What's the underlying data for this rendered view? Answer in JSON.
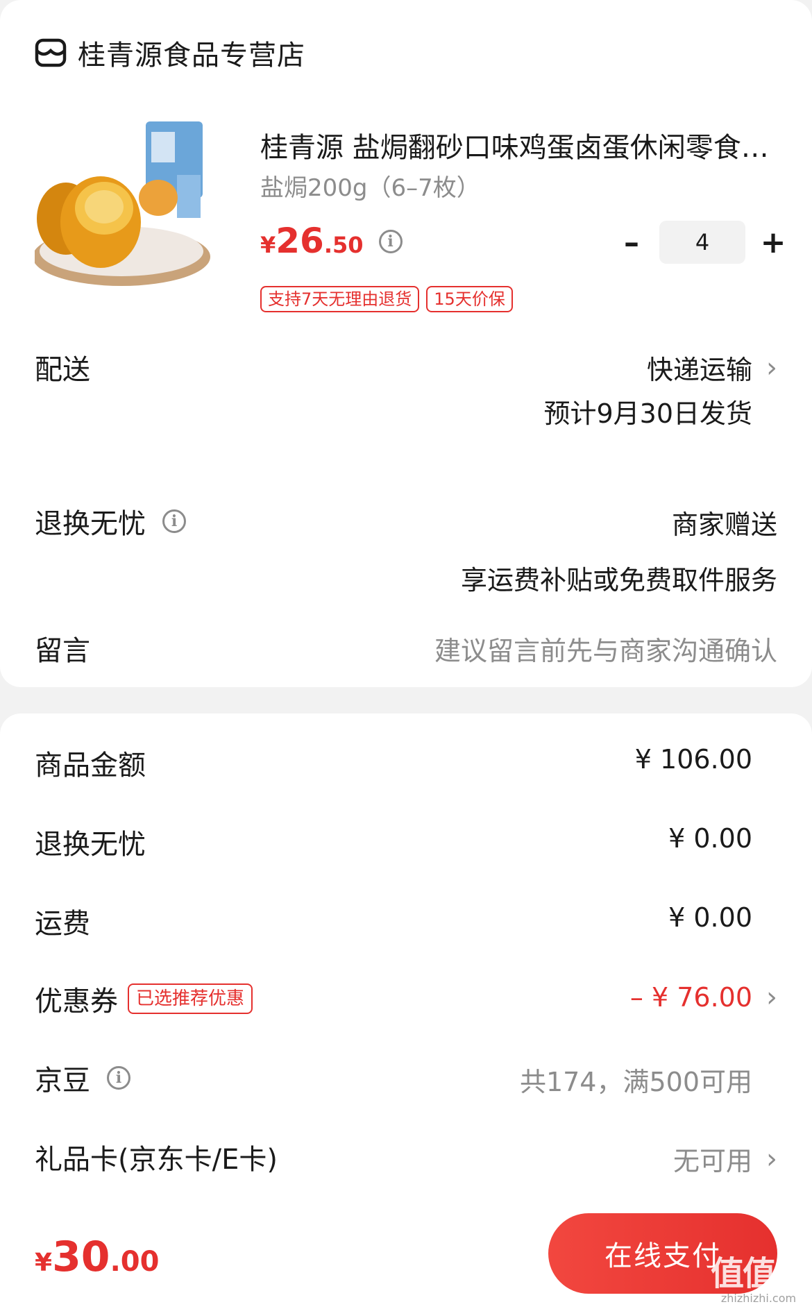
{
  "store": {
    "name": "桂青源食品专营店",
    "icon": "store-icon"
  },
  "product": {
    "title": "桂青源 盐焗翻砂口味鸡蛋卤蛋休闲零食小吃",
    "spec": "盐焗200g（6–7枚）",
    "price_symbol": "¥",
    "price_int": "26",
    "price_dec": ".50",
    "quantity": "4",
    "minus_label": "–",
    "plus_label": "+",
    "tags": [
      "支持7天无理由退货",
      "15天价保"
    ]
  },
  "delivery": {
    "label": "配送",
    "method": "快递运输",
    "eta": "预计9月30日发货"
  },
  "return_service": {
    "label": "退换无忧",
    "value": "商家赠送",
    "desc": "享运费补贴或免费取件服务"
  },
  "message": {
    "label": "留言",
    "placeholder": "建议留言前先与商家沟通确认"
  },
  "summary": {
    "goods_amount_label": "商品金额",
    "goods_amount": "¥ 106.00",
    "return_label": "退换无忧",
    "return_amount": "¥ 0.00",
    "freight_label": "运费",
    "freight_amount": "¥ 0.00",
    "coupon_label": "优惠券",
    "coupon_tag": "已选推荐优惠",
    "coupon_amount": "– ¥ 76.00",
    "jd_bean_label": "京豆",
    "jd_bean_value": "共174，满500可用",
    "gift_card_label": "礼品卡(京东卡/E卡)",
    "gift_card_value": "无可用"
  },
  "footer": {
    "total_symbol": "¥",
    "total_int": "30",
    "total_dec": ".00",
    "pay_label": "在线支付",
    "watermark_big": "值值值",
    "watermark_small": "zhizhizhi.com"
  },
  "colors": {
    "accent": "#e5302e",
    "gray": "#8c8c8c",
    "text": "#1a1a1a",
    "background": "#f2f2f2"
  }
}
